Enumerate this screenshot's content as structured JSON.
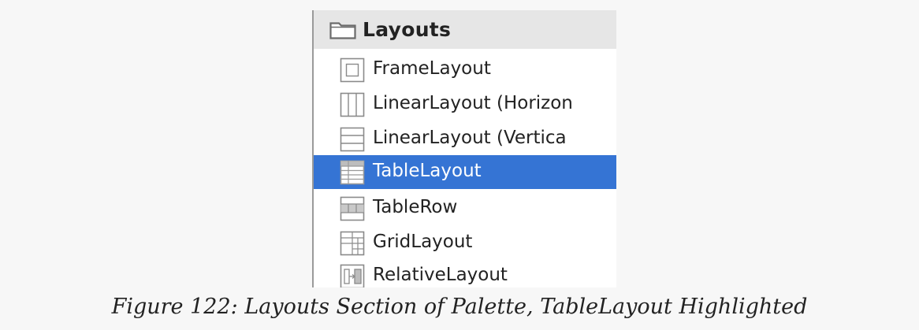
{
  "palette": {
    "section": {
      "title": "Layouts",
      "icon": "folder-icon"
    },
    "items": [
      {
        "label": "FrameLayout",
        "icon": "frame-layout-icon",
        "selected": false
      },
      {
        "label": "LinearLayout (Horizon",
        "icon": "linear-layout-horizontal-icon",
        "selected": false
      },
      {
        "label": "LinearLayout (Vertica",
        "icon": "linear-layout-vertical-icon",
        "selected": false
      },
      {
        "label": "TableLayout",
        "icon": "table-layout-icon",
        "selected": true
      },
      {
        "label": "TableRow",
        "icon": "table-row-icon",
        "selected": false
      },
      {
        "label": "GridLayout",
        "icon": "grid-layout-icon",
        "selected": false
      },
      {
        "label": "RelativeLayout",
        "icon": "relative-layout-icon",
        "selected": false
      }
    ],
    "colors": {
      "selection": "#3574d4",
      "header_bg": "#e6e6e6"
    }
  },
  "caption": "Figure 122: Layouts Section of Palette, TableLayout Highlighted"
}
